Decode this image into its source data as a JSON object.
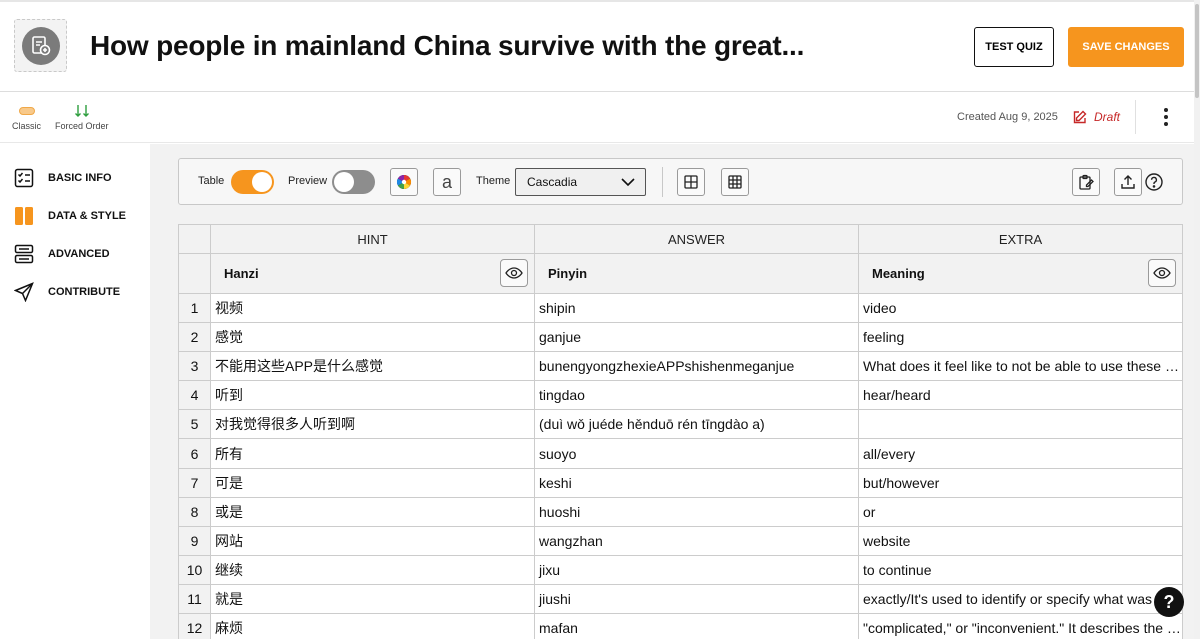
{
  "header": {
    "title": "How people in mainland China survive with the great...",
    "test_quiz_label": "TEST QUIZ",
    "save_label": "SAVE CHANGES"
  },
  "modes": {
    "classic_label": "Classic",
    "forced_order_label": "Forced Order"
  },
  "meta": {
    "created": "Created Aug 9, 2025",
    "status": "Draft"
  },
  "sidebar": {
    "items": [
      {
        "label": "BASIC INFO",
        "icon": "checklist-icon"
      },
      {
        "label": "DATA & STYLE",
        "icon": "columns-icon"
      },
      {
        "label": "ADVANCED",
        "icon": "sliders-icon"
      },
      {
        "label": "CONTRIBUTE",
        "icon": "paper-plane-icon"
      }
    ]
  },
  "toolbar": {
    "table_label": "Table",
    "table_on": true,
    "preview_label": "Preview",
    "preview_on": false,
    "font_glyph": "a",
    "theme_label": "Theme",
    "theme_value": "Cascadia"
  },
  "table": {
    "groups": [
      "HINT",
      "ANSWER",
      "EXTRA"
    ],
    "columns": [
      "Hanzi",
      "Pinyin",
      "Meaning"
    ],
    "rows": [
      {
        "n": "1",
        "hint": "视频",
        "answer": "shipin",
        "extra": "video"
      },
      {
        "n": "2",
        "hint": "感觉",
        "answer": "ganjue",
        "extra": "feeling"
      },
      {
        "n": "3",
        "hint": "不能用这些APP是什么感觉",
        "answer": "bunengyongzhexieAPPshishenmeganjue",
        "extra": "What does it feel like to not be able to use these …"
      },
      {
        "n": "4",
        "hint": "听到",
        "answer": "tingdao",
        "extra": "hear/heard"
      },
      {
        "n": "5",
        "hint": "对我觉得很多人听到啊",
        "answer": "(duì wǒ juéde hěnduō rén tīngdào a)",
        "extra": ""
      },
      {
        "n": "6",
        "hint": "所有",
        "answer": "suoyo",
        "extra": "all/every"
      },
      {
        "n": "7",
        "hint": "可是",
        "answer": "keshi",
        "extra": "but/however"
      },
      {
        "n": "8",
        "hint": "或是",
        "answer": "huoshi",
        "extra": "or"
      },
      {
        "n": "9",
        "hint": "网站",
        "answer": "wangzhan",
        "extra": "website"
      },
      {
        "n": "10",
        "hint": "继续",
        "answer": "jixu",
        "extra": "to continue"
      },
      {
        "n": "11",
        "hint": "就是",
        "answer": "jiushi",
        "extra": "exactly/It's used to identify or specify what was"
      },
      {
        "n": "12",
        "hint": "麻烦",
        "answer": "mafan",
        "extra": "\"complicated,\" or \"inconvenient.\" It describes the …"
      }
    ]
  },
  "help_fab": "?",
  "colors": {
    "accent": "#f6951e",
    "draft": "#c62828",
    "forced_order": "#2e9e3e"
  }
}
